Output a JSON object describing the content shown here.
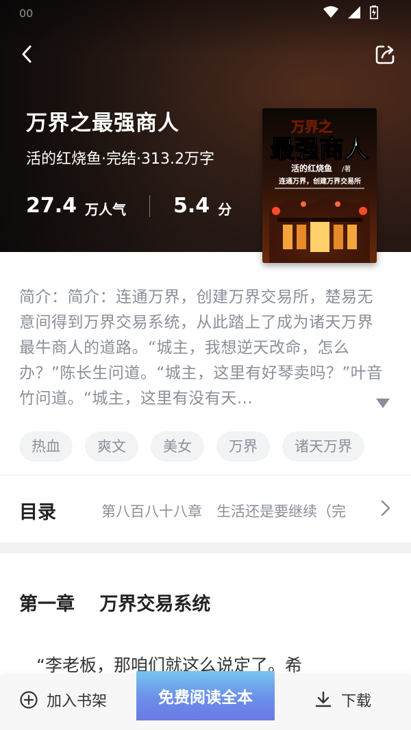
{
  "status": {
    "time": "00"
  },
  "header": {
    "title": "万界之最强商人",
    "meta": "活的红烧鱼·完结·313.2万字",
    "stats": [
      {
        "value": "27.4",
        "unit": "万人气"
      },
      {
        "value": "5.4",
        "unit": "分"
      }
    ]
  },
  "cover": {
    "title_top": "万界之",
    "title_main": "最强商人",
    "author": "活的红烧鱼",
    "author_suffix": "/著",
    "tagline": "连通万界，创建万界交易所"
  },
  "intro": {
    "text": "简介：简介：连通万界，创建万界交易所，楚易无意间得到万界交易系统，从此踏上了成为诸天万界最牛商人的道路。“城主，我想逆天改命，怎么办？”陈长生问道。“城主，这里有好琴卖吗？”叶音竹问道。“城主，这里有没有天…"
  },
  "tags": [
    "热血",
    "爽文",
    "美女",
    "万界",
    "诸天万界"
  ],
  "catalog": {
    "label": "目录",
    "latest": "第八百八十八章　生活还是要继续（完"
  },
  "chapter": {
    "title": "第一章　 万界交易系统",
    "text": "　“李老板，那咱们就这么说定了。希"
  },
  "bottom_bar": {
    "shelf_label": "加入书架",
    "read_label": "免费阅读全本",
    "download_label": "下载"
  },
  "colors": {
    "accent_gradient_top": "#78c5ee",
    "accent_gradient_bottom": "#6a79e6",
    "muted_text": "#8a8f99"
  }
}
